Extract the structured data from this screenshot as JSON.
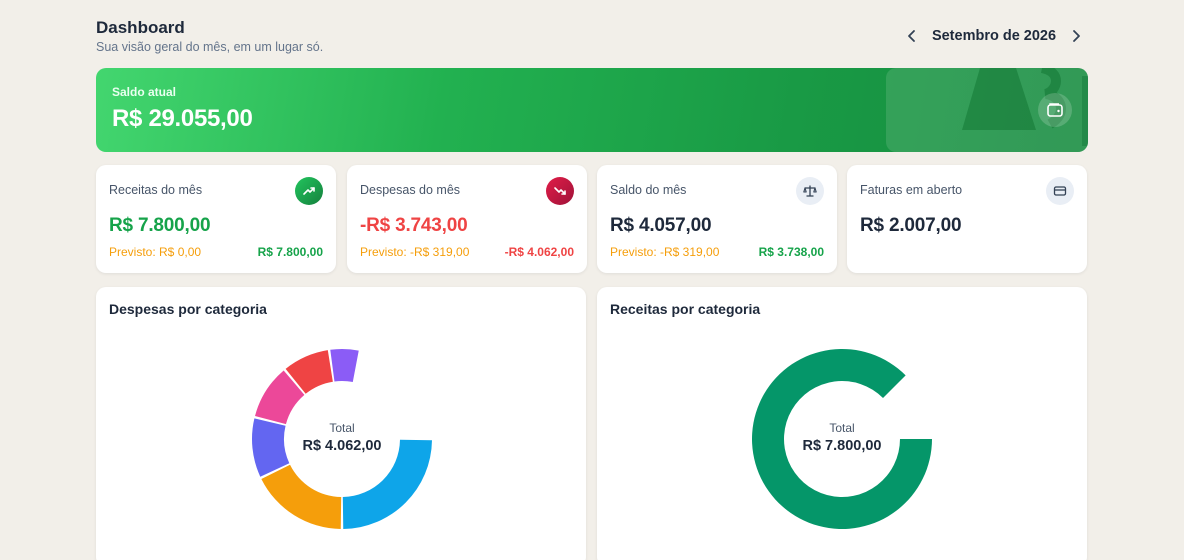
{
  "header": {
    "title": "Dashboard",
    "subtitle": "Sua visão geral do mês, em um lugar só.",
    "month": "Setembro de 2026"
  },
  "balance": {
    "label": "Saldo atual",
    "value": "R$ 29.055,00"
  },
  "stats": [
    {
      "label": "Receitas do mês",
      "value": "R$ 7.800,00",
      "forecast": "Previsto: R$ 0,00",
      "foot_value": "R$ 7.800,00",
      "icon": "trending-up-icon",
      "value_color": "#16a34a",
      "foot_color": "#16a34a"
    },
    {
      "label": "Despesas do mês",
      "value": "-R$ 3.743,00",
      "forecast": "Previsto: -R$ 319,00",
      "foot_value": "-R$ 4.062,00",
      "icon": "trending-down-icon",
      "value_color": "#ef4444",
      "foot_color": "#ef4444"
    },
    {
      "label": "Saldo do mês",
      "value": "R$ 4.057,00",
      "forecast": "Previsto: -R$ 319,00",
      "foot_value": "R$ 3.738,00",
      "icon": "scale-icon",
      "value_color": "#1e293b",
      "foot_color": "#16a34a"
    },
    {
      "label": "Faturas em aberto",
      "value": "R$ 2.007,00",
      "icon": "credit-card-icon",
      "value_color": "#1e293b"
    }
  ],
  "charts": {
    "expenses": {
      "title": "Despesas por categoria",
      "total_label": "Total",
      "total_value": "R$ 4.062,00"
    },
    "income": {
      "title": "Receitas por categoria",
      "total_label": "Total",
      "total_value": "R$ 7.800,00"
    }
  },
  "chart_data": [
    {
      "type": "pie",
      "title": "Despesas por categoria",
      "slices": [
        {
          "value": 0.25,
          "color": "#0ea5e9"
        },
        {
          "value": 0.179,
          "color": "#f59e0b"
        },
        {
          "value": 0.11,
          "color": "#6366f1"
        },
        {
          "value": 0.101,
          "color": "#ec4899"
        },
        {
          "value": 0.087,
          "color": "#ef4444"
        },
        {
          "value": 0.055,
          "color": "#8b5cf6"
        }
      ]
    },
    {
      "type": "pie",
      "title": "Receitas por categoria",
      "slices": [
        {
          "value": 0.875,
          "color": "#059669"
        }
      ]
    }
  ]
}
